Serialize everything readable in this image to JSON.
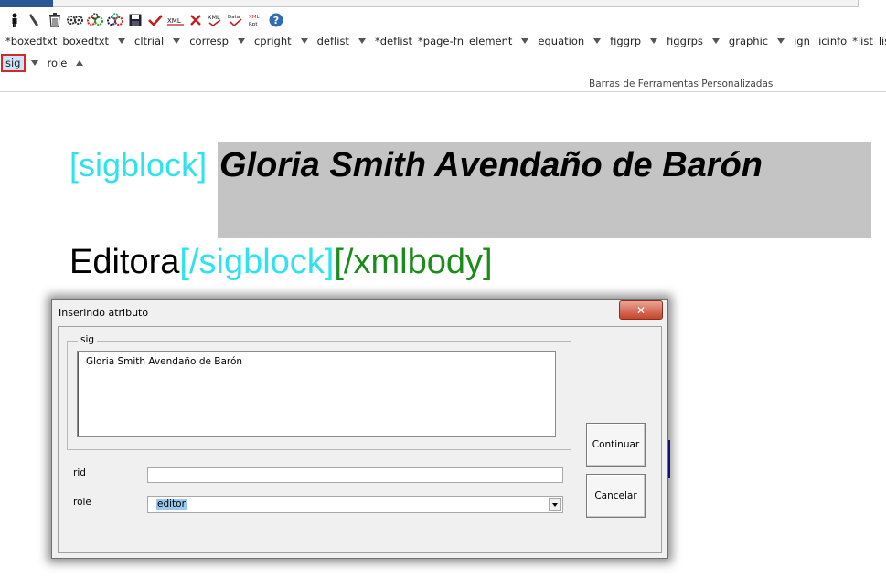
{
  "ribbon": {
    "icons": [
      "person-icon",
      "pen-icon",
      "trash-icon",
      "gears-icon",
      "gears-color-icon",
      "gears-blue-icon",
      "save-icon",
      "check-icon",
      "xml-icon",
      "close-x-icon",
      "xml-check-icon",
      "data-check-icon",
      "xml-report-icon",
      "help-icon"
    ],
    "tags_row1": [
      {
        "label": "*boxedtxt",
        "arrow": false
      },
      {
        "label": "boxedtxt",
        "arrow": true
      },
      {
        "label": "cltrial",
        "arrow": true
      },
      {
        "label": "corresp",
        "arrow": true
      },
      {
        "label": "cpright",
        "arrow": true
      },
      {
        "label": "deflist",
        "arrow": true
      },
      {
        "label": "*deflist",
        "arrow": false
      },
      {
        "label": "*page-fn",
        "arrow": false
      },
      {
        "label": "element",
        "arrow": true
      },
      {
        "label": "equation",
        "arrow": true
      },
      {
        "label": "figgrp",
        "arrow": true
      },
      {
        "label": "figgrps",
        "arrow": true
      },
      {
        "label": "graphic",
        "arrow": true
      },
      {
        "label": "ign",
        "arrow": false
      },
      {
        "label": "licinfo",
        "arrow": false
      },
      {
        "label": "*list",
        "arrow": false
      },
      {
        "label": "list",
        "arrow": true
      }
    ],
    "tag_sig": "sig",
    "tag_role": "role",
    "group_label": "Barras de Ferramentas Personalizadas"
  },
  "document": {
    "sigblock_open": "[sigblock]",
    "name": "Gloria Smith Avendaño de Barón",
    "role_text": "Editora",
    "sigblock_close": "[/sigblock]",
    "xmlbody_close": "[/xmlbody]"
  },
  "dialog": {
    "title": "Inserindo atributo",
    "close_symbol": "✕",
    "group_legend": "sig",
    "sig_value": "Gloria Smith Avendaño de Barón",
    "rid_label": "rid",
    "rid_value": "",
    "role_label": "role",
    "role_value": "editor",
    "continue_label": "Continuar",
    "cancel_label": "Cancelar"
  },
  "colors": {
    "tag_cyan": "#2ee2ee",
    "tag_green": "#1a8c1a",
    "name_highlight": "#c4c4c4",
    "selected_highlight": "#99c9ef",
    "active_tag_border": "#d12a2a"
  }
}
